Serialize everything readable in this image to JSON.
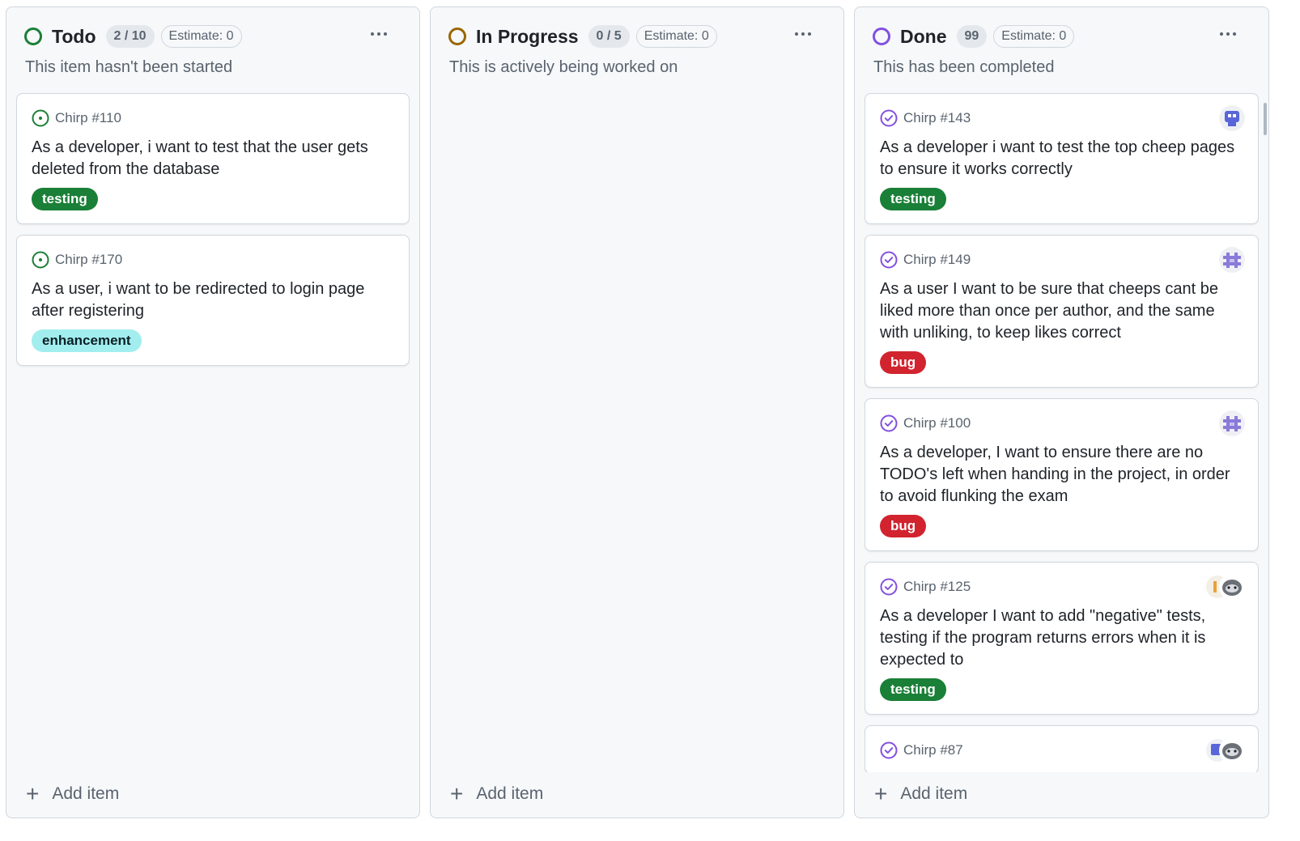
{
  "columns": [
    {
      "name": "Todo",
      "count": "2 / 10",
      "estimate": "Estimate: 0",
      "description": "This item hasn't been started",
      "add_label": "Add item",
      "status_color": "#1a7f37",
      "cards": [
        {
          "ref": "Chirp #110",
          "title": "As a developer, i want to test that the user gets deleted from the database",
          "label": "testing"
        },
        {
          "ref": "Chirp #170",
          "title": "As a user, i want to be redirected to login page after registering",
          "label": "enhancement"
        }
      ]
    },
    {
      "name": "In Progress",
      "count": "0 / 5",
      "estimate": "Estimate: 0",
      "description": "This is actively being worked on",
      "add_label": "Add item",
      "status_color": "#9a6700",
      "cards": []
    },
    {
      "name": "Done",
      "count": "99",
      "estimate": "Estimate: 0",
      "description": "This has been completed",
      "add_label": "Add item",
      "status_color": "#8250df",
      "cards": [
        {
          "ref": "Chirp #143",
          "title": "As a developer i want to test the top cheep pages to ensure it works correctly",
          "label": "testing"
        },
        {
          "ref": "Chirp #149",
          "title": "As a user I want to be sure that cheeps cant be liked more than once per author, and the same with unliking, to keep likes correct",
          "label": "bug"
        },
        {
          "ref": "Chirp #100",
          "title": "As a developer, I want to ensure there are no TODO's left when handing in the project, in order to avoid flunking the exam",
          "label": "bug"
        },
        {
          "ref": "Chirp #125",
          "title": "As a developer I want to add \"negative\" tests, testing if the program returns errors when it is expected to",
          "label": "testing"
        },
        {
          "ref": "Chirp #87"
        }
      ]
    }
  ],
  "label_colors": {
    "testing": "#1a7f37",
    "bug": "#d1242f",
    "enhancement": "#a2eeef"
  }
}
